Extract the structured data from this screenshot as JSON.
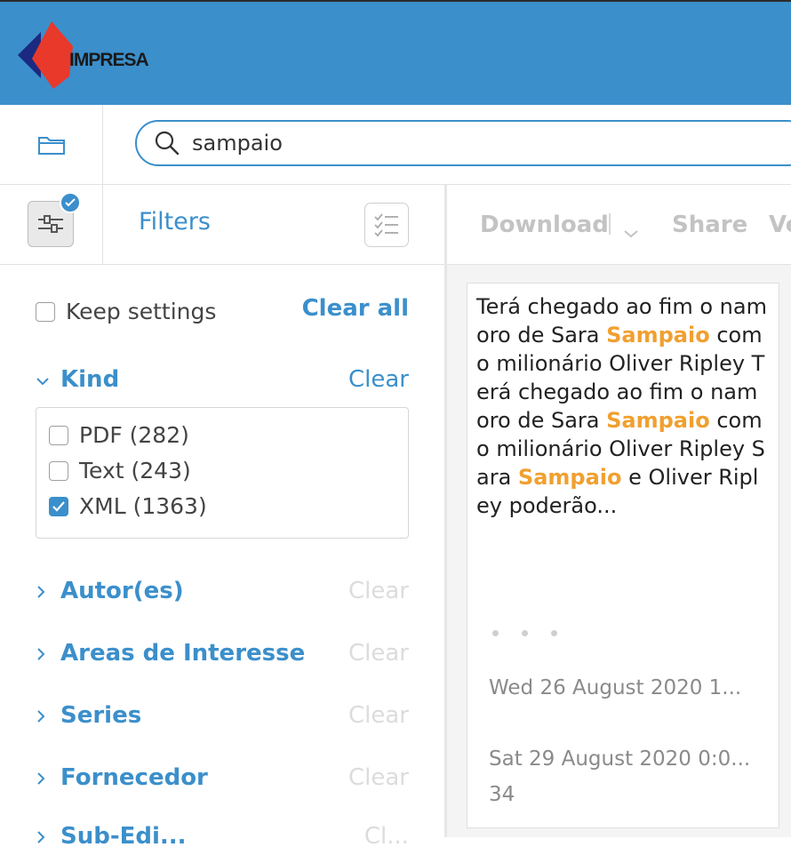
{
  "brand": {
    "logo_text": "IMPRESA",
    "colors": {
      "header": "#3b8fcb",
      "accent": "#3b8fcb",
      "highlight": "#f0a030",
      "logo_red": "#e8392b",
      "logo_navy": "#1b2a80"
    }
  },
  "search": {
    "value": "sampaio",
    "icon": "search-icon"
  },
  "filters_bar": {
    "title": "Filters"
  },
  "sidebar": {
    "keep_settings_label": "Keep settings",
    "clear_all_label": "Clear all",
    "kind": {
      "label": "Kind",
      "clear_label": "Clear",
      "items": [
        {
          "label": "PDF (282)",
          "checked": false
        },
        {
          "label": "Text (243)",
          "checked": false
        },
        {
          "label": "XML (1363)",
          "checked": true
        }
      ]
    },
    "sections": [
      {
        "label": "Autor(es)",
        "clear_label": "Clear"
      },
      {
        "label": "Areas de Interesse",
        "clear_label": "Clear"
      },
      {
        "label": "Series",
        "clear_label": "Clear"
      },
      {
        "label": "Fornecedor",
        "clear_label": "Clear"
      },
      {
        "label": "Sub-Edi...",
        "clear_label": "Cl..."
      }
    ]
  },
  "toolbar": {
    "download_label": "Download",
    "share_label": "Share",
    "more_label": "Ve"
  },
  "result": {
    "snippet_parts": [
      {
        "text": "Terá chegado ao fim o namoro de Sara ",
        "hl": false
      },
      {
        "text": "Sampaio",
        "hl": true
      },
      {
        "text": " com o milionário Oliver Ripley Terá chegado ao fim o namoro de Sara ",
        "hl": false
      },
      {
        "text": "Sampaio",
        "hl": true
      },
      {
        "text": " com o milionário Oliver Ripley Sara ",
        "hl": false
      },
      {
        "text": "Sampaio",
        "hl": true
      },
      {
        "text": " e Oliver Ripley poderão...",
        "hl": false
      }
    ],
    "date1": "Wed 26 August 2020 1...",
    "date2": "Sat 29 August 2020 0:0...",
    "count": "34"
  }
}
